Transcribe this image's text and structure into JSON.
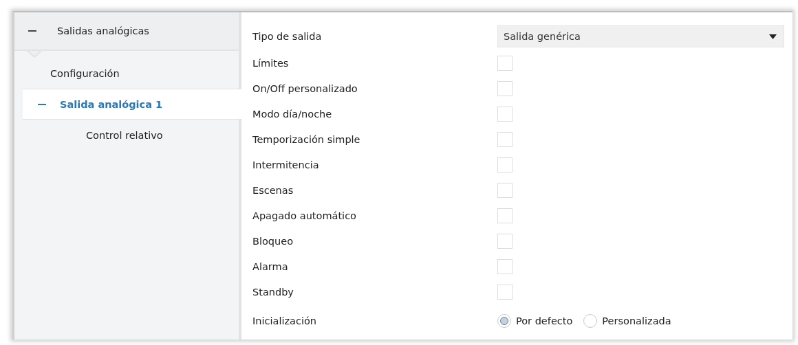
{
  "sidebar": {
    "tree": [
      {
        "label": "Salidas analógicas",
        "expanded": true,
        "selected": false,
        "children": [
          {
            "label": "Configuración",
            "selected": false
          },
          {
            "label": "Salida analógica 1",
            "expanded": true,
            "selected": true,
            "children": [
              {
                "label": "Control relativo",
                "selected": false
              }
            ]
          }
        ]
      }
    ]
  },
  "parameters": [
    {
      "kind": "dropdown",
      "label": "Tipo de salida",
      "value": "Salida genérica"
    },
    {
      "kind": "checkbox",
      "label": "Límites",
      "checked": false
    },
    {
      "kind": "checkbox",
      "label": "On/Off personalizado",
      "checked": false
    },
    {
      "kind": "checkbox",
      "label": "Modo día/noche",
      "checked": false
    },
    {
      "kind": "checkbox",
      "label": "Temporización simple",
      "checked": false
    },
    {
      "kind": "checkbox",
      "label": "Intermitencia",
      "checked": false
    },
    {
      "kind": "checkbox",
      "label": "Escenas",
      "checked": false
    },
    {
      "kind": "checkbox",
      "label": "Apagado automático",
      "checked": false
    },
    {
      "kind": "checkbox",
      "label": "Bloqueo",
      "checked": false
    },
    {
      "kind": "checkbox",
      "label": "Alarma",
      "checked": false
    },
    {
      "kind": "checkbox",
      "label": "Standby",
      "checked": false
    },
    {
      "kind": "radio",
      "label": "Inicialización",
      "options": [
        {
          "label": "Por defecto",
          "selected": true
        },
        {
          "label": "Personalizada",
          "selected": false
        }
      ]
    }
  ]
}
